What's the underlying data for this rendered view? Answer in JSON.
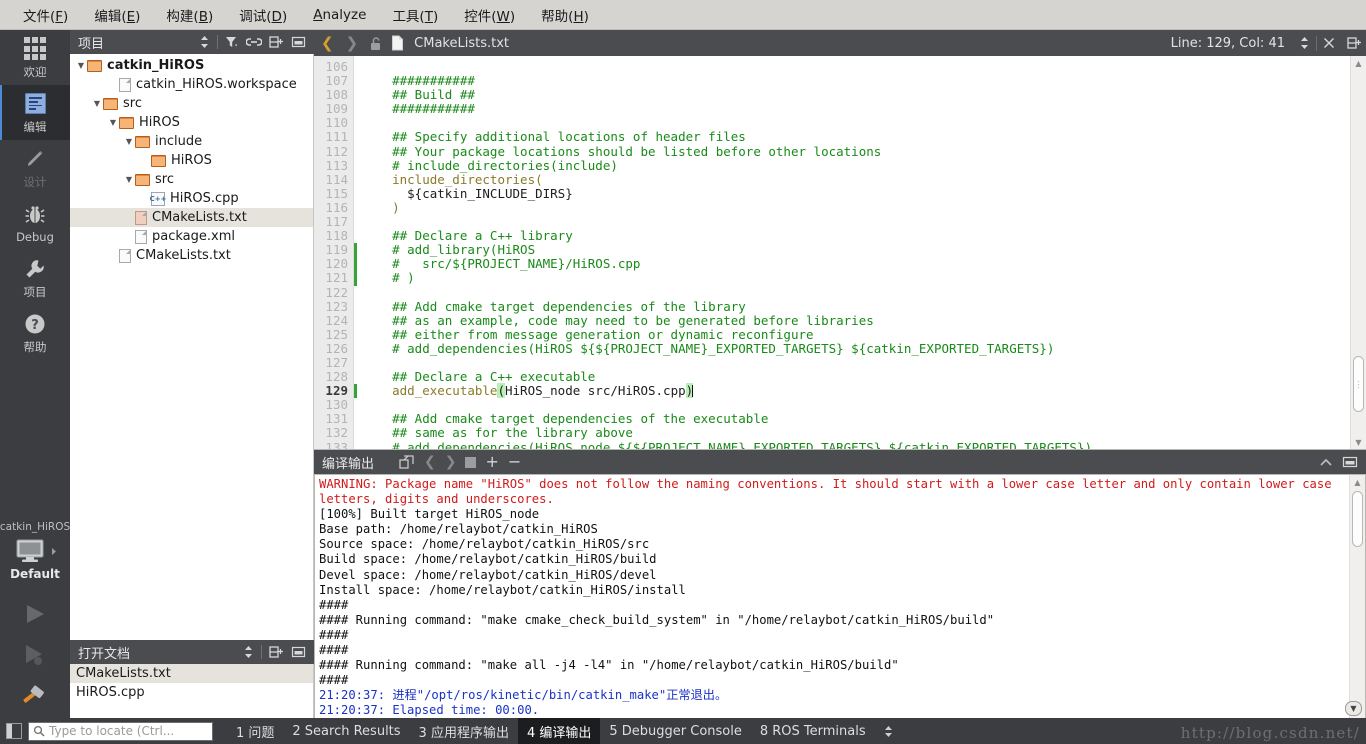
{
  "menubar": [
    {
      "label": "文件(F)",
      "accel": "F"
    },
    {
      "label": "编辑(E)",
      "accel": "E"
    },
    {
      "label": "构建(B)",
      "accel": "B"
    },
    {
      "label": "调试(D)",
      "accel": "D"
    },
    {
      "label": "Analyze",
      "accel": "A"
    },
    {
      "label": "工具(T)",
      "accel": "T"
    },
    {
      "label": "控件(W)",
      "accel": "W"
    },
    {
      "label": "帮助(H)",
      "accel": "H"
    }
  ],
  "modebar": {
    "items": [
      {
        "label": "欢迎",
        "icon": "grid-icon",
        "state": "normal"
      },
      {
        "label": "编辑",
        "icon": "edit-document-icon",
        "state": "active"
      },
      {
        "label": "设计",
        "icon": "pencil-icon",
        "state": "disabled"
      },
      {
        "label": "Debug",
        "icon": "bug-icon",
        "state": "normal"
      },
      {
        "label": "项目",
        "icon": "wrench-icon",
        "state": "normal"
      },
      {
        "label": "帮助",
        "icon": "question-circle-icon",
        "state": "normal"
      }
    ],
    "kit_project": "catkin_HiROS",
    "kit_label": "Default"
  },
  "project_dock": {
    "title": "项目",
    "tools": [
      "sort-icon",
      "filter-icon",
      "link-icon",
      "split-icon",
      "minimize-icon"
    ],
    "tree": [
      {
        "label": "catkin_HiROS",
        "depth": 0,
        "type": "folder",
        "expanded": true,
        "bold": true,
        "selected": false
      },
      {
        "label": "catkin_HiROS.workspace",
        "depth": 2,
        "type": "file",
        "expanded": null,
        "bold": false,
        "selected": false
      },
      {
        "label": "src",
        "depth": 1,
        "type": "folder",
        "expanded": true,
        "bold": false,
        "selected": false
      },
      {
        "label": "HiROS",
        "depth": 2,
        "type": "folder",
        "expanded": true,
        "bold": false,
        "selected": false
      },
      {
        "label": "include",
        "depth": 3,
        "type": "folder",
        "expanded": true,
        "bold": false,
        "selected": false
      },
      {
        "label": "HiROS",
        "depth": 4,
        "type": "folder",
        "expanded": null,
        "bold": false,
        "selected": false
      },
      {
        "label": "src",
        "depth": 3,
        "type": "folder",
        "expanded": true,
        "bold": false,
        "selected": false
      },
      {
        "label": "HiROS.cpp",
        "depth": 4,
        "type": "cpp",
        "expanded": null,
        "bold": false,
        "selected": false
      },
      {
        "label": "CMakeLists.txt",
        "depth": 3,
        "type": "file-pink",
        "expanded": null,
        "bold": false,
        "selected": true
      },
      {
        "label": "package.xml",
        "depth": 3,
        "type": "file",
        "expanded": null,
        "bold": false,
        "selected": false
      },
      {
        "label": "CMakeLists.txt",
        "depth": 2,
        "type": "file",
        "expanded": null,
        "bold": false,
        "selected": false
      }
    ]
  },
  "opendocs_dock": {
    "title": "打开文档",
    "tools": [
      "sort-icon",
      "split-icon",
      "minimize-icon"
    ],
    "items": [
      {
        "label": "CMakeLists.txt",
        "selected": true
      },
      {
        "label": "HiROS.cpp",
        "selected": false
      }
    ]
  },
  "editor_bar": {
    "back_icon": "chevron-left-icon",
    "forward_icon": "chevron-right-icon",
    "lock_icon": "unlock-icon",
    "file_icon": "file-icon",
    "filename": "CMakeLists.txt",
    "dropdown_icon": "updown-arrow-icon",
    "close_icon": "close-icon",
    "line_col": "Line: 129, Col: 41",
    "split_icon": "split-icon"
  },
  "editor": {
    "first_line": 106,
    "current_line": 129,
    "lines": [
      {
        "n": 106,
        "segments": []
      },
      {
        "n": 107,
        "segments": [
          {
            "t": "    ###########",
            "c": "cmt"
          }
        ]
      },
      {
        "n": 108,
        "segments": [
          {
            "t": "    ## Build ##",
            "c": "cmt"
          }
        ]
      },
      {
        "n": 109,
        "segments": [
          {
            "t": "    ###########",
            "c": "cmt"
          }
        ]
      },
      {
        "n": 110,
        "segments": []
      },
      {
        "n": 111,
        "segments": [
          {
            "t": "    ## Specify additional locations of header files",
            "c": "cmt"
          }
        ]
      },
      {
        "n": 112,
        "segments": [
          {
            "t": "    ## Your package locations should be listed before other locations",
            "c": "cmt"
          }
        ]
      },
      {
        "n": 113,
        "segments": [
          {
            "t": "    # include_directories(include)",
            "c": "cmt"
          }
        ]
      },
      {
        "n": 114,
        "segments": [
          {
            "t": "    include_directories(",
            "c": "fn"
          }
        ]
      },
      {
        "n": 115,
        "segments": [
          {
            "t": "      ${catkin_INCLUDE_DIRS}",
            "c": "var"
          }
        ]
      },
      {
        "n": 116,
        "segments": [
          {
            "t": "    )",
            "c": "fn"
          }
        ]
      },
      {
        "n": 117,
        "segments": []
      },
      {
        "n": 118,
        "segments": [
          {
            "t": "    ## Declare a C++ library",
            "c": "cmt"
          }
        ]
      },
      {
        "n": 119,
        "segments": [
          {
            "t": "    # add_library(HiROS",
            "c": "cmt"
          }
        ]
      },
      {
        "n": 120,
        "segments": [
          {
            "t": "    #   src/${PROJECT_NAME}/HiROS.cpp",
            "c": "cmt"
          }
        ]
      },
      {
        "n": 121,
        "segments": [
          {
            "t": "    # )",
            "c": "cmt"
          }
        ]
      },
      {
        "n": 122,
        "segments": []
      },
      {
        "n": 123,
        "segments": [
          {
            "t": "    ## Add cmake target dependencies of the library",
            "c": "cmt"
          }
        ]
      },
      {
        "n": 124,
        "segments": [
          {
            "t": "    ## as an example, code may need to be generated before libraries",
            "c": "cmt"
          }
        ]
      },
      {
        "n": 125,
        "segments": [
          {
            "t": "    ## either from message generation or dynamic reconfigure",
            "c": "cmt"
          }
        ]
      },
      {
        "n": 126,
        "segments": [
          {
            "t": "    # add_dependencies(HiROS ${${PROJECT_NAME}_EXPORTED_TARGETS} ${catkin_EXPORTED_TARGETS})",
            "c": "cmt"
          }
        ]
      },
      {
        "n": 127,
        "segments": []
      },
      {
        "n": 128,
        "segments": [
          {
            "t": "    ## Declare a C++ executable",
            "c": "cmt"
          }
        ]
      },
      {
        "n": 129,
        "segments": [
          {
            "t": "    add_executable",
            "c": "fn"
          },
          {
            "t": "(",
            "c": "par"
          },
          {
            "t": "HiROS_node src/HiROS.cpp",
            "c": "var"
          },
          {
            "t": ")",
            "c": "par"
          },
          {
            "t": "",
            "c": "caret"
          }
        ]
      },
      {
        "n": 130,
        "segments": []
      },
      {
        "n": 131,
        "segments": [
          {
            "t": "    ## Add cmake target dependencies of the executable",
            "c": "cmt"
          }
        ]
      },
      {
        "n": 132,
        "segments": [
          {
            "t": "    ## same as for the library above",
            "c": "cmt"
          }
        ]
      },
      {
        "n": 133,
        "segments": [
          {
            "t": "    # add_dependencies(HiROS_node ${${PROJECT_NAME}_EXPORTED_TARGETS} ${catkin_EXPORTED_TARGETS})",
            "c": "cmt"
          }
        ]
      }
    ]
  },
  "output_pane": {
    "title": "编译输出",
    "tools": [
      "open-in-editor-icon",
      "prev-icon",
      "next-icon",
      "stop-icon",
      "zoom-in-icon",
      "zoom-out-icon",
      "collapse-icon",
      "maximize-icon"
    ],
    "lines": [
      {
        "t": "WARNING: Package name \"HiROS\" does not follow the naming conventions. It should start with a lower case letter and only contain lower case",
        "c": "warn"
      },
      {
        "t": "letters, digits and underscores.",
        "c": "warn"
      },
      {
        "t": "[100%] Built target HiROS_node",
        "c": "plain"
      },
      {
        "t": "Base path: /home/relaybot/catkin_HiROS",
        "c": "plain"
      },
      {
        "t": "Source space: /home/relaybot/catkin_HiROS/src",
        "c": "plain"
      },
      {
        "t": "Build space: /home/relaybot/catkin_HiROS/build",
        "c": "plain"
      },
      {
        "t": "Devel space: /home/relaybot/catkin_HiROS/devel",
        "c": "plain"
      },
      {
        "t": "Install space: /home/relaybot/catkin_HiROS/install",
        "c": "plain"
      },
      {
        "t": "####",
        "c": "plain"
      },
      {
        "t": "#### Running command: \"make cmake_check_build_system\" in \"/home/relaybot/catkin_HiROS/build\"",
        "c": "plain"
      },
      {
        "t": "####",
        "c": "plain"
      },
      {
        "t": "####",
        "c": "plain"
      },
      {
        "t": "#### Running command: \"make all -j4 -l4\" in \"/home/relaybot/catkin_HiROS/build\"",
        "c": "plain"
      },
      {
        "t": "####",
        "c": "plain"
      },
      {
        "t": "21:20:37: 进程\"/opt/ros/kinetic/bin/catkin_make\"正常退出。",
        "c": "info"
      },
      {
        "t": "21:20:37: Elapsed time: 00:00.",
        "c": "info"
      }
    ]
  },
  "statusbar": {
    "sidebar_toggle_icon": "sidebar-toggle-icon",
    "locate_icon": "search-icon",
    "locate_placeholder": "Type to locate (Ctrl...",
    "tabs": [
      {
        "num": "1",
        "label": "问题",
        "active": false
      },
      {
        "num": "2",
        "label": "Search Results",
        "active": false
      },
      {
        "num": "3",
        "label": "应用程序输出",
        "active": false
      },
      {
        "num": "4",
        "label": "编译输出",
        "active": true
      },
      {
        "num": "5",
        "label": "Debugger Console",
        "active": false
      },
      {
        "num": "8",
        "label": "ROS Terminals",
        "active": false
      }
    ],
    "updown_icon": "updown-arrow-icon"
  },
  "watermark": "http://blog.csdn.net/"
}
